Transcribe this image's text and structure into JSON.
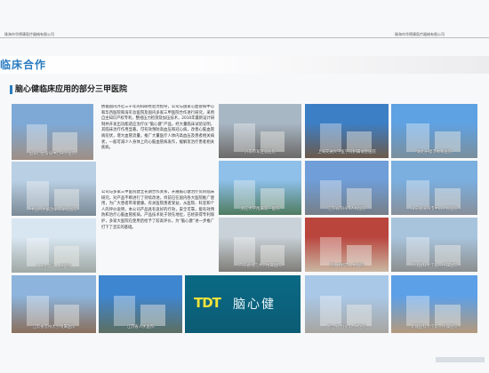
{
  "header": {
    "left": "珠海市华德康医疗器械有限公司",
    "right": "珠海市华德康医疗器械有限公司"
  },
  "section": {
    "band_title": "临床合作",
    "subtitle": "脑心健临床应用的部分三甲医院"
  },
  "paragraphs": [
    "依据国内外近三十年的科研经验为指导，公司与国家心血管病中心和华西医院和海军总医院及国内多家三甲医院合作进行研究，采用自主知识产权专利，整组压力检测及加压技术，2010年最新设计研制并开发出功能适应治疗仪“脑心健”产品，经大量临床试验证明，其临床治疗作用显著。可有效预防高血压和冠心病，改善心脑血管病症状，增大血管流量，推广大量医疗人体内高血压及患者相关病状，一般可减少人身体上的心脑血管病发作，缓解及治疗患者相关疾病。",
    "公司与多家三甲医院建立长期合作关系，开展脑心健治疗仪的临床研究，对产品不断进行了持续改进，目前已在国内各大医院推广使用，为广大患者带来健康。有关医院患者受益，从医院、科室和个人的评价说明，本公司产品具有良好的疗效，安全可靠，能有效预防和治疗心脑血管疾病。产品技术处于领先地位，已经获得专利保护，多家大医院在使用后给予了较高评价。为“脑心健”进一步推广打下了坚实的基础。"
  ],
  "hospitals": [
    {
      "name": "国家心血管病中心阜外医院",
      "color_top": "#7ea9d6",
      "color_bottom": "#9f8f84"
    },
    {
      "name": "中国人民解放军海军总医院",
      "color_top": "#b9cfe3",
      "color_bottom": "#7b8a96"
    },
    {
      "name": "广州市第一人民医院",
      "color_top": "#d8e6f1",
      "color_bottom": "#9fa8a3"
    },
    {
      "name": "江苏省苏州大学附属医院",
      "color_top": "#8db4dc",
      "color_bottom": "#8a6f5c"
    },
    {
      "name": "江苏省人民医院",
      "color_top": "#3f86d0",
      "color_bottom": "#5c6f62"
    },
    {
      "name": "济南市军区总医院",
      "color_top": "#a8b7c4",
      "color_bottom": "#6b6a68"
    },
    {
      "name": "上海交通大学医学院附属瑞金医院",
      "color_top": "#3d7fc5",
      "color_bottom": "#6c5a4b"
    },
    {
      "name": "湖北十堰市太和医院",
      "color_top": "#5fa2e3",
      "color_bottom": "#7b8f9c"
    },
    {
      "name": "浙江大学附属第一医院",
      "color_top": "#8ec0ea",
      "color_bottom": "#4f7c60"
    },
    {
      "name": "江苏省苏州市人民医院",
      "color_top": "#6f9ed8",
      "color_bottom": "#777f88"
    },
    {
      "name": "山东省滨州市中心人民医院",
      "color_top": "#7aafe0",
      "color_bottom": "#88909a"
    },
    {
      "name": "广东省北京大学附属医院",
      "color_top": "#c9d2d8",
      "color_bottom": "#7f7d78"
    },
    {
      "name": "河北邯郸市人民医院",
      "color_top": "#b9453d",
      "color_bottom": "#c9b7a3"
    },
    {
      "name": "河北医科大学第一附属医院",
      "color_top": "#a8c4dd",
      "color_bottom": "#8d8f8f"
    },
    {
      "name": "浙江省温州市人民医院",
      "color_top": "#a9c8e8",
      "color_bottom": "#a8a5a0"
    },
    {
      "name": "新疆医科大学第一附属医院",
      "color_top": "#5ca0e8",
      "color_bottom": "#b49a7c"
    }
  ],
  "brand": {
    "mark": "TDT",
    "name": "脑心健"
  }
}
